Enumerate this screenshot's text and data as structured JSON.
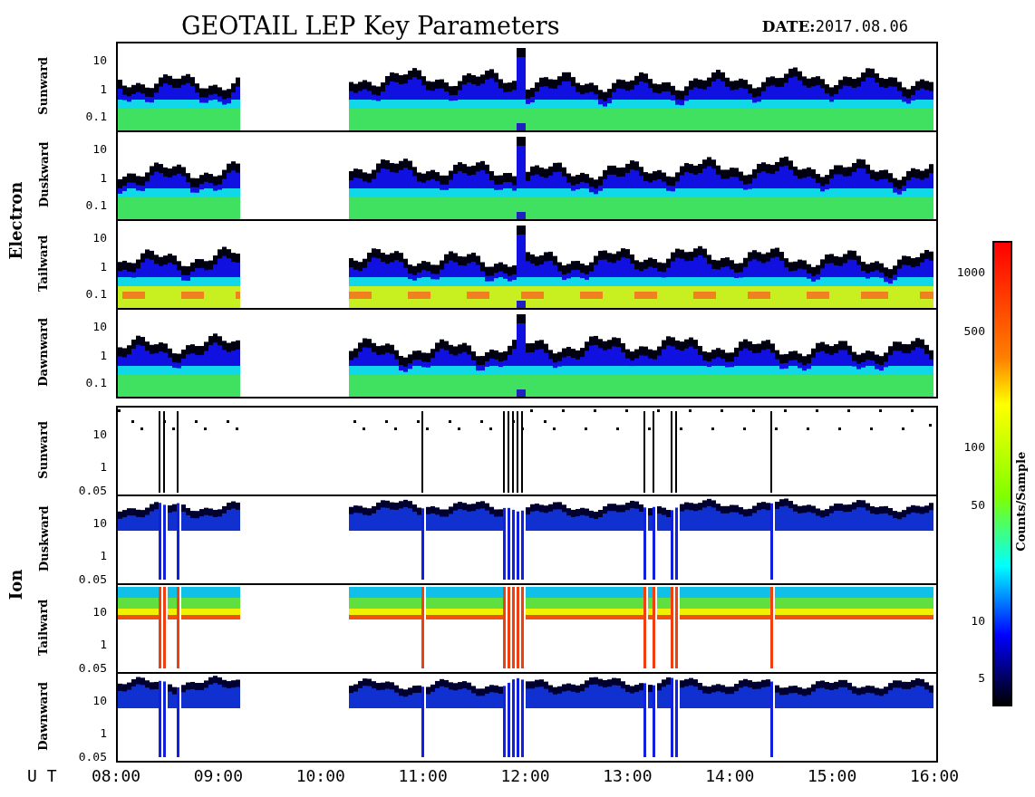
{
  "title": "GEOTAIL LEP Key Parameters",
  "date_label": "DATE:",
  "date": "2017.08.06",
  "groups": [
    {
      "name": "Electron",
      "kind": "electron",
      "panels": [
        {
          "direction": "Sunward",
          "yticks": [
            "10",
            "1",
            "0.1"
          ]
        },
        {
          "direction": "Duskward",
          "yticks": [
            "10",
            "1",
            "0.1"
          ]
        },
        {
          "direction": "Tailward",
          "yticks": [
            "10",
            "1",
            "0.1"
          ]
        },
        {
          "direction": "Dawnward",
          "yticks": [
            "10",
            "1",
            "0.1"
          ]
        }
      ]
    },
    {
      "name": "Ion",
      "kind": "ion",
      "panels": [
        {
          "direction": "Sunward",
          "yticks": [
            "10",
            "1",
            "0.05"
          ]
        },
        {
          "direction": "Duskward",
          "yticks": [
            "10",
            "1",
            "0.05"
          ]
        },
        {
          "direction": "Tailward",
          "yticks": [
            "10",
            "1",
            "0.05"
          ]
        },
        {
          "direction": "Dawnward",
          "yticks": [
            "10",
            "1",
            "0.05"
          ]
        }
      ]
    }
  ],
  "colorbar": {
    "label": "Counts/Sample",
    "ticks": [
      "1000",
      "500",
      "100",
      "50",
      "10",
      "5"
    ]
  },
  "time_axis": {
    "label": "U T",
    "ticks": [
      "08:00",
      "09:00",
      "10:00",
      "11:00",
      "12:00",
      "13:00",
      "14:00",
      "15:00",
      "16:00"
    ]
  }
}
